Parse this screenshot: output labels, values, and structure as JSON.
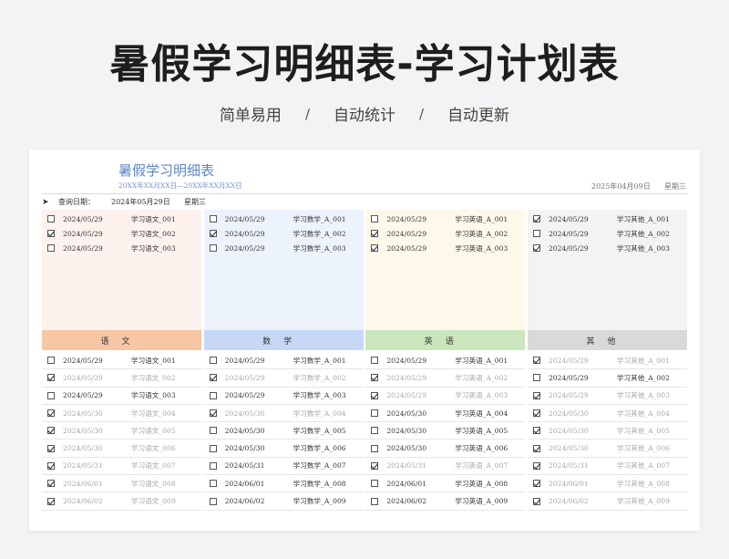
{
  "hero": {
    "title": "暑假学习明细表-学习计划表",
    "tags": [
      "简单易用",
      "自动统计",
      "自动更新"
    ],
    "separator": "/"
  },
  "sheet": {
    "title": "暑假学习明细表",
    "range": "20XX年XX月XX日—20XX年XX月XX日",
    "current_date": "2025年04月09日",
    "current_week": "星期三",
    "query_label": "查询日期：",
    "query_date": "2024年05月29日",
    "query_week": "星期三"
  },
  "colors": {
    "chinese_bg": "#fdf2ee",
    "chinese_header": "#f7c6a4",
    "math_bg": "#edf3fd",
    "math_header": "#c6d8f6",
    "english_bg": "#fdf8ea",
    "english_header": "#cbe6bc",
    "other_bg": "#f3f3f3",
    "other_header": "#d9d9d9"
  },
  "columns": [
    {
      "key": "chinese",
      "header": "语文",
      "summary": [
        {
          "checked": false,
          "date": "2024/05/29",
          "name": "学习语文_001"
        },
        {
          "checked": true,
          "date": "2024/05/29",
          "name": "学习语文_002"
        },
        {
          "checked": false,
          "date": "2024/05/29",
          "name": "学习语文_003"
        }
      ],
      "items": [
        {
          "checked": false,
          "date": "2024/05/29",
          "name": "学习语文_001"
        },
        {
          "checked": true,
          "date": "2024/05/29",
          "name": "学习语文_002"
        },
        {
          "checked": false,
          "date": "2024/05/29",
          "name": "学习语文_003"
        },
        {
          "checked": true,
          "date": "2024/05/30",
          "name": "学习语文_004"
        },
        {
          "checked": true,
          "date": "2024/05/30",
          "name": "学习语文_005"
        },
        {
          "checked": true,
          "date": "2024/05/30",
          "name": "学习语文_006"
        },
        {
          "checked": true,
          "date": "2024/05/31",
          "name": "学习语文_007"
        },
        {
          "checked": true,
          "date": "2024/06/01",
          "name": "学习语文_008"
        },
        {
          "checked": true,
          "date": "2024/06/02",
          "name": "学习语文_009"
        }
      ]
    },
    {
      "key": "math",
      "header": "数学",
      "summary": [
        {
          "checked": false,
          "date": "2024/05/29",
          "name": "学习数学_A_001"
        },
        {
          "checked": true,
          "date": "2024/05/29",
          "name": "学习数学_A_002"
        },
        {
          "checked": false,
          "date": "2024/05/29",
          "name": "学习数学_A_003"
        }
      ],
      "items": [
        {
          "checked": false,
          "date": "2024/05/29",
          "name": "学习数学_A_001"
        },
        {
          "checked": true,
          "date": "2024/05/29",
          "name": "学习数学_A_002"
        },
        {
          "checked": false,
          "date": "2024/05/29",
          "name": "学习数学_A_003"
        },
        {
          "checked": true,
          "date": "2024/05/30",
          "name": "学习数学_A_004"
        },
        {
          "checked": false,
          "date": "2024/05/30",
          "name": "学习数学_A_005"
        },
        {
          "checked": false,
          "date": "2024/05/30",
          "name": "学习数学_A_006"
        },
        {
          "checked": false,
          "date": "2024/05/31",
          "name": "学习数学_A_007"
        },
        {
          "checked": false,
          "date": "2024/06/01",
          "name": "学习数学_A_008"
        },
        {
          "checked": false,
          "date": "2024/06/02",
          "name": "学习数学_A_009"
        }
      ]
    },
    {
      "key": "english",
      "header": "英语",
      "summary": [
        {
          "checked": false,
          "date": "2024/05/29",
          "name": "学习英语_A_001"
        },
        {
          "checked": true,
          "date": "2024/05/29",
          "name": "学习英语_A_002"
        },
        {
          "checked": true,
          "date": "2024/05/29",
          "name": "学习英语_A_003"
        }
      ],
      "items": [
        {
          "checked": false,
          "date": "2024/05/29",
          "name": "学习英语_A_001"
        },
        {
          "checked": true,
          "date": "2024/05/29",
          "name": "学习英语_A_002"
        },
        {
          "checked": true,
          "date": "2024/05/29",
          "name": "学习英语_A_003"
        },
        {
          "checked": false,
          "date": "2024/05/30",
          "name": "学习英语_A_004"
        },
        {
          "checked": false,
          "date": "2024/05/30",
          "name": "学习英语_A_005"
        },
        {
          "checked": false,
          "date": "2024/05/30",
          "name": "学习英语_A_006"
        },
        {
          "checked": true,
          "date": "2024/05/31",
          "name": "学习英语_A_007"
        },
        {
          "checked": false,
          "date": "2024/06/01",
          "name": "学习英语_A_008"
        },
        {
          "checked": false,
          "date": "2024/06/02",
          "name": "学习英语_A_009"
        }
      ]
    },
    {
      "key": "other",
      "header": "其他",
      "summary": [
        {
          "checked": true,
          "date": "2024/05/29",
          "name": "学习其他_A_001"
        },
        {
          "checked": false,
          "date": "2024/05/29",
          "name": "学习其他_A_002"
        },
        {
          "checked": true,
          "date": "2024/05/29",
          "name": "学习其他_A_003"
        }
      ],
      "items": [
        {
          "checked": true,
          "date": "2024/05/29",
          "name": "学习其他_A_001"
        },
        {
          "checked": false,
          "date": "2024/05/29",
          "name": "学习其他_A_002"
        },
        {
          "checked": true,
          "date": "2024/05/29",
          "name": "学习其他_A_003"
        },
        {
          "checked": true,
          "date": "2024/05/30",
          "name": "学习其他_A_004"
        },
        {
          "checked": true,
          "date": "2024/05/30",
          "name": "学习其他_A_005"
        },
        {
          "checked": true,
          "date": "2024/05/30",
          "name": "学习其他_A_006"
        },
        {
          "checked": true,
          "date": "2024/05/31",
          "name": "学习其他_A_007"
        },
        {
          "checked": true,
          "date": "2024/06/01",
          "name": "学习其他_A_008"
        },
        {
          "checked": true,
          "date": "2024/06/02",
          "name": "学习其他_A_009"
        }
      ]
    }
  ]
}
